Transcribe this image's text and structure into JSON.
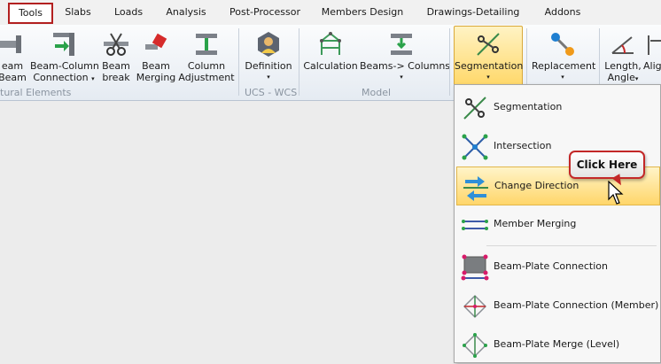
{
  "menubar": {
    "tabs": [
      {
        "label": "Tools",
        "active": true
      },
      {
        "label": "Slabs"
      },
      {
        "label": "Loads"
      },
      {
        "label": "Analysis"
      },
      {
        "label": "Post-Processor"
      },
      {
        "label": "Members Design"
      },
      {
        "label": "Drawings-Detailing"
      },
      {
        "label": "Addons"
      }
    ]
  },
  "ribbon": {
    "buttons": {
      "beam_beam": {
        "line1": "eam",
        "line2": "Beam"
      },
      "beam_column": {
        "line1": "Beam-Column",
        "line2": "Connection"
      },
      "beam_break": {
        "line1": "Beam",
        "line2": "break"
      },
      "beam_merging": {
        "line1": "Beam",
        "line2": "Merging"
      },
      "column_adjustment": {
        "line1": "Column",
        "line2": "Adjustment"
      },
      "definition": {
        "line1": "Definition"
      },
      "calculation": {
        "line1": "Calculation"
      },
      "beams_columns": {
        "line1": "Beams-> Columns"
      },
      "segmentation": {
        "line1": "Segmentation"
      },
      "replacement": {
        "line1": "Replacement"
      },
      "length_angle": {
        "line1": "Length,",
        "line2": "Angle"
      },
      "align": {
        "line1": "Alig"
      }
    },
    "groups": {
      "structural": "tural Elements",
      "ucs": "UCS - WCS",
      "model": "Model"
    },
    "caret": "▾"
  },
  "dropdown": {
    "items": [
      {
        "label": "Segmentation"
      },
      {
        "label": "Intersection"
      },
      {
        "label": "Change Direction",
        "highlighted": true
      },
      {
        "label": "Member Merging"
      },
      {
        "label": "Beam-Plate Connection"
      },
      {
        "label": "Beam-Plate Connection (Member)"
      },
      {
        "label": "Beam-Plate Merge (Level)"
      }
    ]
  },
  "callout": {
    "text": "Click Here"
  },
  "colors": {
    "accent_red": "#c32828",
    "highlight": "#ffd66a",
    "ribbon_bg": "#e5ebf2"
  }
}
